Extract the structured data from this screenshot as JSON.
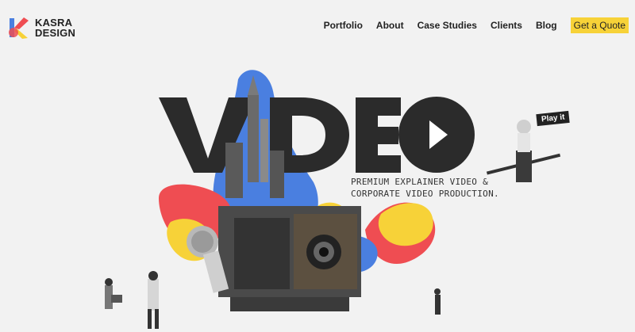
{
  "logo": {
    "line1": "KASRA",
    "line2": "DESIGN"
  },
  "nav": {
    "items": [
      {
        "label": "Portfolio"
      },
      {
        "label": "About"
      },
      {
        "label": "Case Studies"
      },
      {
        "label": "Clients"
      },
      {
        "label": "Blog"
      }
    ],
    "cta_label": "Get a Quote"
  },
  "hero": {
    "headline": "VIDEO",
    "tagline_line1": "PREMIUM EXPLAINER VIDEO &",
    "tagline_line2": "CORPORATE VIDEO PRODUCTION.",
    "flag_text": "Play it"
  },
  "colors": {
    "accent_yellow": "#f7d238",
    "blob_blue": "#4a7fe0",
    "blob_red": "#ef4d52",
    "text_dark": "#222222"
  }
}
